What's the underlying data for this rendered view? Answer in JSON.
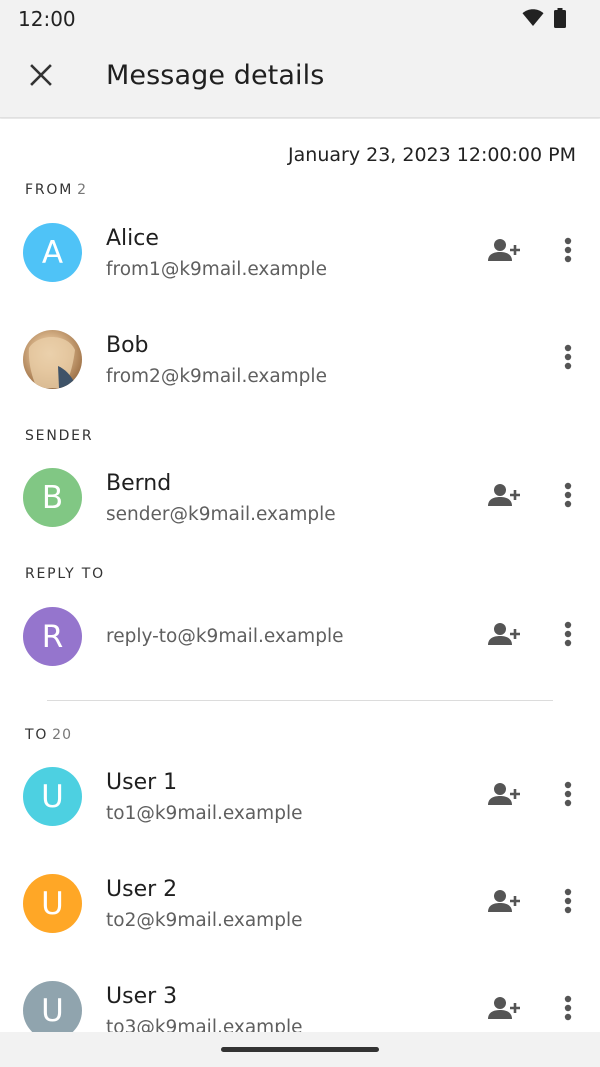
{
  "status_bar": {
    "time": "12:00",
    "icons": [
      "wifi-icon",
      "battery-icon"
    ]
  },
  "app_bar": {
    "title": "Message details",
    "close_icon": "close-icon"
  },
  "date": "January 23, 2023 12:00:00 PM",
  "sections": {
    "from": {
      "label": "FROM",
      "count": "2",
      "items": [
        {
          "name": "Alice",
          "email": "from1@k9mail.example",
          "initial": "A",
          "color": "#4fc3f7",
          "add_contact": true
        },
        {
          "name": "Bob",
          "email": "from2@k9mail.example",
          "initial": "",
          "photo": true,
          "add_contact": false
        }
      ]
    },
    "sender": {
      "label": "SENDER",
      "items": [
        {
          "name": "Bernd",
          "email": "sender@k9mail.example",
          "initial": "B",
          "color": "#81c784",
          "add_contact": true
        }
      ]
    },
    "reply_to": {
      "label": "REPLY TO",
      "items": [
        {
          "name": "",
          "email": "reply-to@k9mail.example",
          "initial": "R",
          "color": "#9575cd",
          "add_contact": true
        }
      ]
    },
    "to": {
      "label": "TO",
      "count": "20",
      "items": [
        {
          "name": "User 1",
          "email": "to1@k9mail.example",
          "initial": "U",
          "color": "#4dd0e1",
          "add_contact": true
        },
        {
          "name": "User 2",
          "email": "to2@k9mail.example",
          "initial": "U",
          "color": "#ffa726",
          "add_contact": true
        },
        {
          "name": "User 3",
          "email": "to3@k9mail.example",
          "initial": "U",
          "color": "#90a4ae",
          "add_contact": true
        }
      ]
    }
  }
}
